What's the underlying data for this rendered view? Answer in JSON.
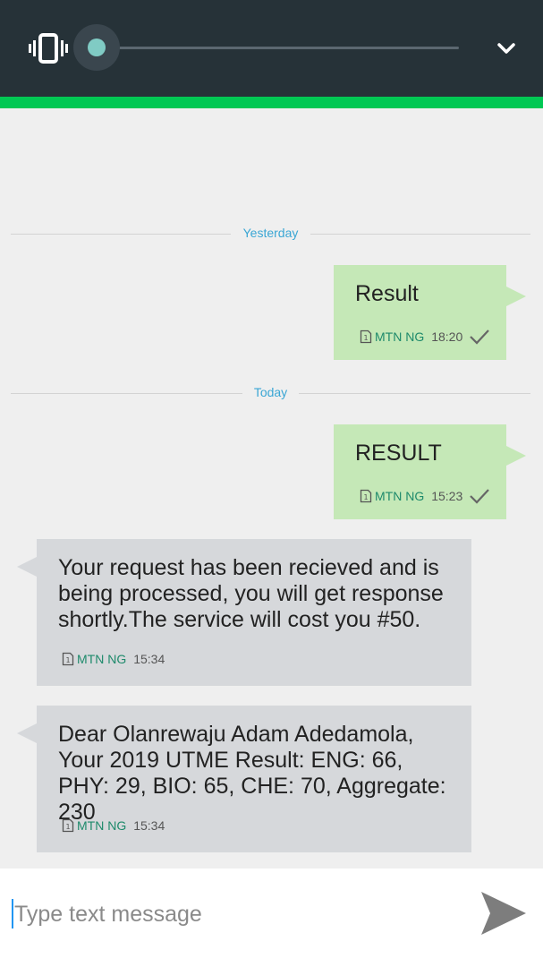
{
  "volume": {
    "level": 0.0,
    "icon": "vibrate-icon",
    "expand_icon": "chevron-down-icon"
  },
  "colors": {
    "panel_bg": "#263238",
    "accent_strip": "#00c853",
    "outgoing_bubble": "#c5e8b7",
    "incoming_bubble": "#d6d8db",
    "date_label": "#3aa6d4",
    "carrier_text": "#1e8a6b"
  },
  "separators": [
    {
      "label": "Yesterday"
    },
    {
      "label": "Today"
    }
  ],
  "messages": [
    {
      "direction": "outgoing",
      "text": "Result",
      "carrier": "MTN NG",
      "time": "18:20",
      "status_icon": "check-icon"
    },
    {
      "direction": "outgoing",
      "text": "RESULT",
      "carrier": "MTN NG",
      "time": "15:23",
      "status_icon": "check-icon"
    },
    {
      "direction": "incoming",
      "text": "Your request has been recieved and is being processed, you will get response shortly.The service will cost you #50.",
      "carrier": "MTN NG",
      "time": "15:34"
    },
    {
      "direction": "incoming",
      "text": "Dear Olanrewaju Adam Adedamola, Your 2019 UTME Result: ENG: 66, PHY: 29, BIO: 65, CHE: 70, Aggregate: 230",
      "carrier": "MTN NG",
      "time": "15:34"
    }
  ],
  "compose": {
    "placeholder": "Type text message",
    "value": "",
    "send_icon": "send-icon"
  }
}
